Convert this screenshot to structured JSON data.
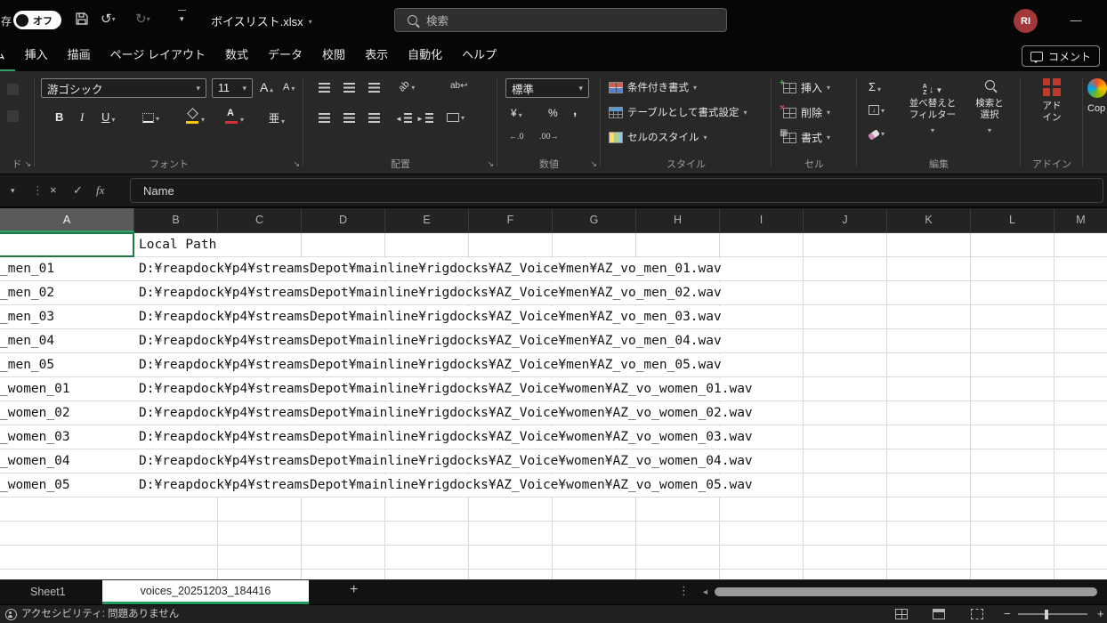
{
  "titlebar": {
    "autosave_partial": "存",
    "autosave_state": "オフ",
    "filename": "ボイスリスト.xlsx",
    "search_placeholder": "検索",
    "avatar_initials": "RI",
    "minimize_glyph": "—"
  },
  "ribbon_tabs": {
    "home": "ホーム",
    "items": [
      "挿入",
      "描画",
      "ページ レイアウト",
      "数式",
      "データ",
      "校閲",
      "表示",
      "自動化",
      "ヘルプ"
    ],
    "comments": "コメント"
  },
  "ribbon": {
    "clipboard": {
      "label_partial": "ド"
    },
    "font": {
      "family": "游ゴシック",
      "size": "11",
      "bold": "B",
      "italic": "I",
      "underline": "U",
      "grow_glyph": "A",
      "shrink_glyph": "A",
      "color_glyph": "A",
      "phonetic_glyph": "亜",
      "label": "フォント"
    },
    "alignment": {
      "orientation_glyph": "ab",
      "wrap_glyph": "ab",
      "label": "配置"
    },
    "number": {
      "format": "標準",
      "currency_glyph": "¥",
      "percent_glyph": "%",
      "comma_glyph": ",",
      "dec_increase": "←.0",
      "dec_decrease": ".00→",
      "label": "数値"
    },
    "styles": {
      "conditional": "条件付き書式",
      "format_as_table": "テーブルとして書式設定",
      "cell_styles": "セルのスタイル",
      "label": "スタイル"
    },
    "cells": {
      "insert": "挿入",
      "delete": "削除",
      "format": "書式",
      "label": "セル"
    },
    "editing": {
      "sigma": "Σ",
      "sort_icon_top": "A",
      "sort_icon_bottom": "Z",
      "sort_line1": "並べ替えと",
      "sort_line2": "フィルター",
      "find_line1": "検索と",
      "find_line2": "選択",
      "label": "編集"
    },
    "addins": {
      "line1": "アド",
      "line2": "イン",
      "label": "アドイン"
    },
    "copilot_partial": "Cop"
  },
  "formula_bar": {
    "cancel": "×",
    "enter": "✓",
    "fx": "fx",
    "content": "Name"
  },
  "grid": {
    "columns": [
      "A",
      "B",
      "C",
      "D",
      "E",
      "F",
      "G",
      "H",
      "I",
      "J",
      "K",
      "L",
      "M"
    ],
    "rows": [
      {
        "a": "",
        "b": "Local Path"
      },
      {
        "a": "_men_01",
        "b": "D:¥reapdock¥p4¥streamsDepot¥mainline¥rigdocks¥AZ_Voice¥men¥AZ_vo_men_01.wav"
      },
      {
        "a": "_men_02",
        "b": "D:¥reapdock¥p4¥streamsDepot¥mainline¥rigdocks¥AZ_Voice¥men¥AZ_vo_men_02.wav"
      },
      {
        "a": "_men_03",
        "b": "D:¥reapdock¥p4¥streamsDepot¥mainline¥rigdocks¥AZ_Voice¥men¥AZ_vo_men_03.wav"
      },
      {
        "a": "_men_04",
        "b": "D:¥reapdock¥p4¥streamsDepot¥mainline¥rigdocks¥AZ_Voice¥men¥AZ_vo_men_04.wav"
      },
      {
        "a": "_men_05",
        "b": "D:¥reapdock¥p4¥streamsDepot¥mainline¥rigdocks¥AZ_Voice¥men¥AZ_vo_men_05.wav"
      },
      {
        "a": "_women_01",
        "b": "D:¥reapdock¥p4¥streamsDepot¥mainline¥rigdocks¥AZ_Voice¥women¥AZ_vo_women_01.wav"
      },
      {
        "a": "_women_02",
        "b": "D:¥reapdock¥p4¥streamsDepot¥mainline¥rigdocks¥AZ_Voice¥women¥AZ_vo_women_02.wav"
      },
      {
        "a": "_women_03",
        "b": "D:¥reapdock¥p4¥streamsDepot¥mainline¥rigdocks¥AZ_Voice¥women¥AZ_vo_women_03.wav"
      },
      {
        "a": "_women_04",
        "b": "D:¥reapdock¥p4¥streamsDepot¥mainline¥rigdocks¥AZ_Voice¥women¥AZ_vo_women_04.wav"
      },
      {
        "a": "_women_05",
        "b": "D:¥reapdock¥p4¥streamsDepot¥mainline¥rigdocks¥AZ_Voice¥women¥AZ_vo_women_05.wav"
      }
    ]
  },
  "sheet_tabs": {
    "inactive": "Sheet1",
    "active": "voices_20251203_184416",
    "add": "+"
  },
  "status_bar": {
    "accessibility": "アクセシビリティ: 問題ありません"
  }
}
